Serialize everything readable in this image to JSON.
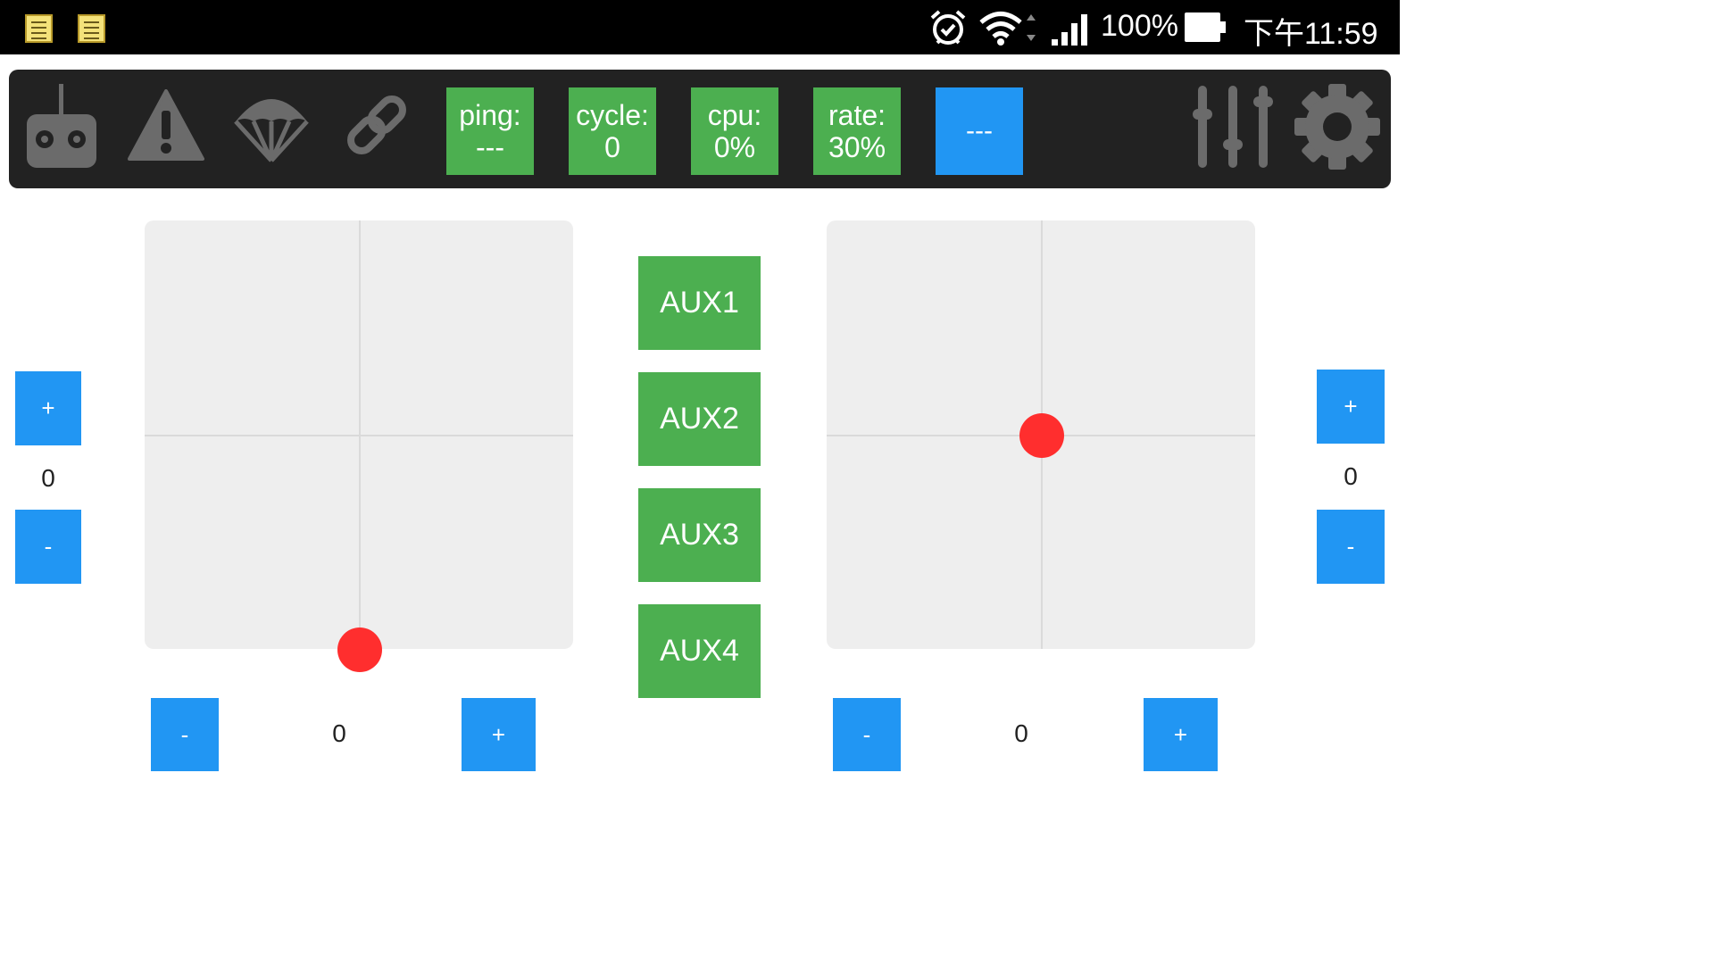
{
  "status_bar": {
    "battery": "100%",
    "time": "下午11:59"
  },
  "toolbar": {
    "icons": [
      "remote-control-icon",
      "warning-icon",
      "parachute-icon",
      "link-icon",
      "sliders-icon",
      "gear-icon"
    ],
    "stats": [
      {
        "label": "ping:",
        "value": "---"
      },
      {
        "label": "cycle:",
        "value": "0"
      },
      {
        "label": "cpu:",
        "value": "0%"
      },
      {
        "label": "rate:",
        "value": "30%"
      }
    ],
    "mode_button": "---"
  },
  "left_stick": {
    "position": {
      "x": 0.0,
      "y": -1.0
    },
    "vertical_trim": {
      "plus": "+",
      "value": "0",
      "minus": "-"
    },
    "horizontal_trim": {
      "minus": "-",
      "value": "0",
      "plus": "+"
    }
  },
  "right_stick": {
    "position": {
      "x": 0.0,
      "y": 0.0
    },
    "vertical_trim": {
      "plus": "+",
      "value": "0",
      "minus": "-"
    },
    "horizontal_trim": {
      "minus": "-",
      "value": "0",
      "plus": "+"
    }
  },
  "aux_buttons": [
    "AUX1",
    "AUX2",
    "AUX3",
    "AUX4"
  ],
  "colors": {
    "accent_green": "#4caf50",
    "accent_blue": "#2196f3",
    "stick_dot": "#ff2e2e",
    "toolbar_bg": "#222222",
    "icon_gray": "#6b6b6b"
  }
}
